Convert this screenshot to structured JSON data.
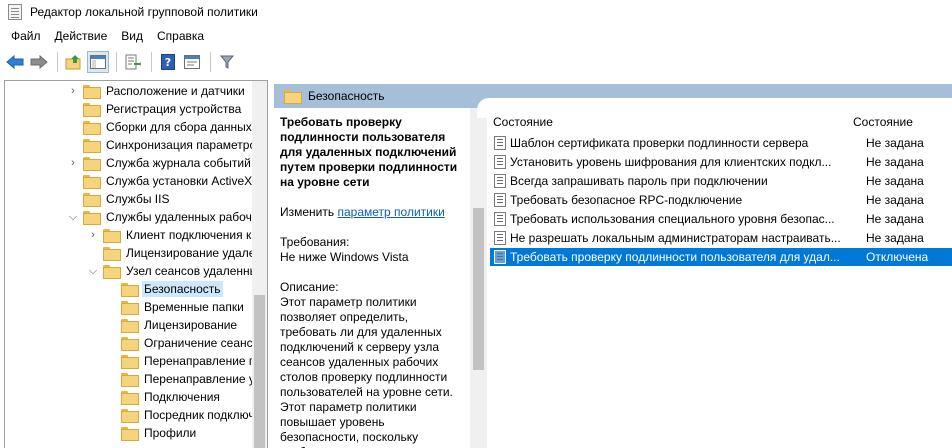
{
  "window": {
    "title": "Редактор локальной групповой политики"
  },
  "menu": [
    "Файл",
    "Действие",
    "Вид",
    "Справка"
  ],
  "toolbar": {
    "buttons": [
      "back-icon",
      "forward-icon",
      "folder-up-icon",
      "show-tree-icon",
      "export-list-icon",
      "help-icon",
      "properties-icon",
      "filter-icon"
    ]
  },
  "tree": {
    "items": [
      {
        "label": "Расположение и датчики",
        "level": 0,
        "expander": "collapsed"
      },
      {
        "label": "Регистрация устройства",
        "level": 0,
        "expander": "none"
      },
      {
        "label": "Сборки для сбора данных",
        "level": 0,
        "expander": "none"
      },
      {
        "label": "Синхронизация параметров",
        "level": 0,
        "expander": "none"
      },
      {
        "label": "Служба журнала событий",
        "level": 0,
        "expander": "collapsed"
      },
      {
        "label": "Служба установки ActiveX",
        "level": 0,
        "expander": "none"
      },
      {
        "label": "Службы IIS",
        "level": 0,
        "expander": "none"
      },
      {
        "label": "Службы удаленных рабочих",
        "level": 0,
        "expander": "expanded"
      },
      {
        "label": "Клиент подключения к",
        "level": 1,
        "expander": "collapsed"
      },
      {
        "label": "Лицензирование удален",
        "level": 1,
        "expander": "none"
      },
      {
        "label": "Узел сеансов удаленных",
        "level": 1,
        "expander": "expanded"
      },
      {
        "label": "Безопасность",
        "level": 2,
        "expander": "none",
        "selected": true
      },
      {
        "label": "Временные папки",
        "level": 2,
        "expander": "none"
      },
      {
        "label": "Лицензирование",
        "level": 2,
        "expander": "none"
      },
      {
        "label": "Ограничение сеансов",
        "level": 2,
        "expander": "none"
      },
      {
        "label": "Перенаправление пр",
        "level": 2,
        "expander": "none"
      },
      {
        "label": "Перенаправление уст",
        "level": 2,
        "expander": "none"
      },
      {
        "label": "Подключения",
        "level": 2,
        "expander": "none"
      },
      {
        "label": "Посредник подключе",
        "level": 2,
        "expander": "none"
      },
      {
        "label": "Профили",
        "level": 2,
        "expander": "none"
      }
    ]
  },
  "section": {
    "title": "Безопасность"
  },
  "description": {
    "title": "Требовать проверку подлинности пользователя для удаленных подключений путем проверки подлинности на уровне сети",
    "edit_prefix": "Изменить",
    "edit_link": "параметр политики",
    "requirements_label": "Требования:",
    "requirements_value": "Не ниже Windows Vista",
    "description_label": "Описание:",
    "description_text": "Этот параметр политики позволяет определить, требовать ли для удаленных подключений к серверу узла сеансов удаленных рабочих столов проверку подлинности пользователей на уровне сети. Этот параметр политики повышает уровень безопасности, поскольку требует проведения проверки"
  },
  "list": {
    "columns": {
      "name": "Состояние",
      "state": "Состояние"
    },
    "rows": [
      {
        "name": "Шаблон сертификата проверки подлинности сервера",
        "state": "Не задана"
      },
      {
        "name": "Установить уровень шифрования для клиентских подкл...",
        "state": "Не задана"
      },
      {
        "name": "Всегда запрашивать пароль при подключении",
        "state": "Не задана"
      },
      {
        "name": "Требовать безопасное RPC-подключение",
        "state": "Не задана"
      },
      {
        "name": "Требовать использования специального уровня безопас...",
        "state": "Не задана"
      },
      {
        "name": "Не разрешать локальным администраторам настраивать...",
        "state": "Не задана"
      },
      {
        "name": "Требовать проверку подлинности пользователя для удал...",
        "state": "Отключена",
        "selected": true
      }
    ]
  },
  "colors": {
    "selection": "#0078d7",
    "header": "#a7bed8",
    "tree_selection": "#cce8ff",
    "link": "#0b5fb5"
  }
}
